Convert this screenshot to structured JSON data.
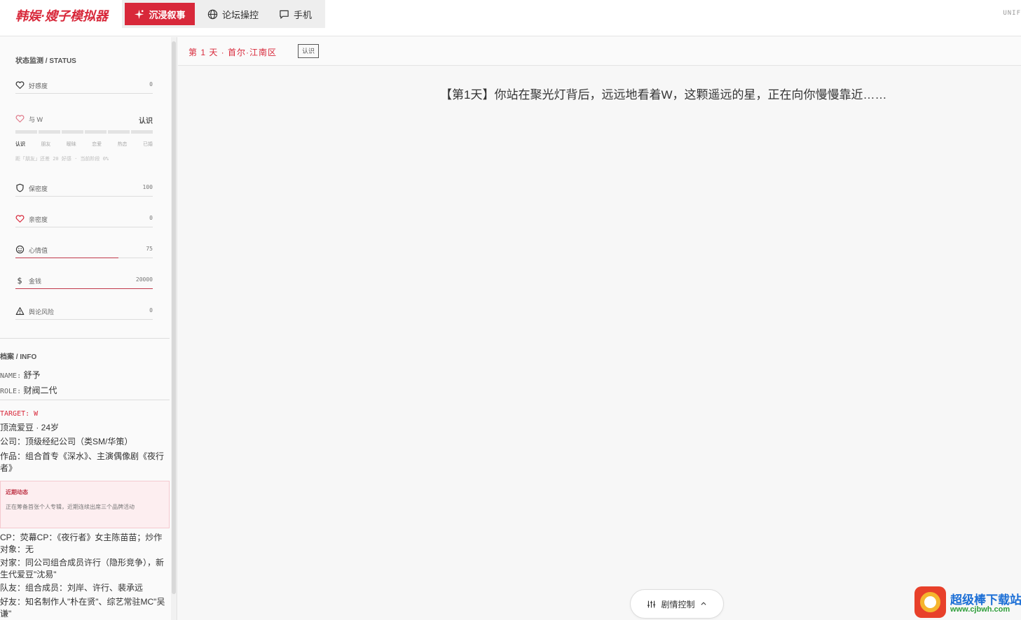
{
  "app": {
    "title": "韩娱·嫂子模拟器",
    "corner_label": "UNIF"
  },
  "tabs": [
    {
      "label": "沉浸叙事",
      "icon": "sparkles-icon",
      "active": true
    },
    {
      "label": "论坛操控",
      "icon": "globe-icon",
      "active": false
    },
    {
      "label": "手机",
      "icon": "chat-icon",
      "active": false
    }
  ],
  "status": {
    "title": "状态监测 / STATUS",
    "affection": {
      "label": "好感度",
      "value": "0",
      "icon": "heart-icon"
    },
    "relation": {
      "label": "与 W",
      "value": "认识",
      "stages": [
        "认识",
        "朋友",
        "暧昧",
        "恋爱",
        "热恋",
        "已婚"
      ],
      "hint": "距「朋友」还差 20 好感 · 当前阶段 0%",
      "icon": "heart-outline-icon"
    },
    "secrecy": {
      "label": "保密度",
      "value": "100",
      "icon": "shield-icon"
    },
    "exposure": {
      "label": "亲密度",
      "value": "0",
      "icon": "heart-icon"
    },
    "mood": {
      "label": "心情值",
      "value": "75",
      "fraction": 0.75,
      "icon": "smile-icon"
    },
    "money": {
      "label": "金钱",
      "value": "20000",
      "fraction": 1.0,
      "icon": "dollar-icon"
    },
    "risk": {
      "label": "舆论风险",
      "value": "0",
      "icon": "warning-icon"
    }
  },
  "info": {
    "title": "档案 / INFO",
    "name_key": "NAME:",
    "name": "舒予",
    "role_key": "ROLE:",
    "role": "财阀二代",
    "target_label": "TARGET: W",
    "target_desc": "顶流爱豆 · 24岁",
    "company": "公司：顶级经纪公司（类SM/华策）",
    "works": "作品：组合首专《深水》、主演偶像剧《夜行者》",
    "news_title": "近期动态",
    "news_body": "正在筹备首张个人专辑，近期连续出席三个品牌活动",
    "cp": "CP：荧幕CP：《夜行者》女主陈苗苗；炒作对象：无",
    "rival": "对家：同公司组合成员许行（隐形竞争），新生代爱豆\"沈易\"",
    "teammates": "队友：组合成员：刘岸、许行、裴承远",
    "friends": "好友：知名制作人\"朴在贤\"、综艺常驻MC\"吴谦\""
  },
  "main": {
    "crumb": "第 1 天 · 首尔·江南区",
    "badge": "认识",
    "narrative": "【第1天】你站在聚光灯背后，远远地看着W，这颗遥远的星，正在向你慢慢靠近……",
    "plot_control": "剧情控制"
  },
  "watermark": {
    "line1": "超级棒下载站",
    "line2": "www.cjbwh.com"
  },
  "colors": {
    "accent": "#d8283a",
    "background": "#fafafa"
  }
}
